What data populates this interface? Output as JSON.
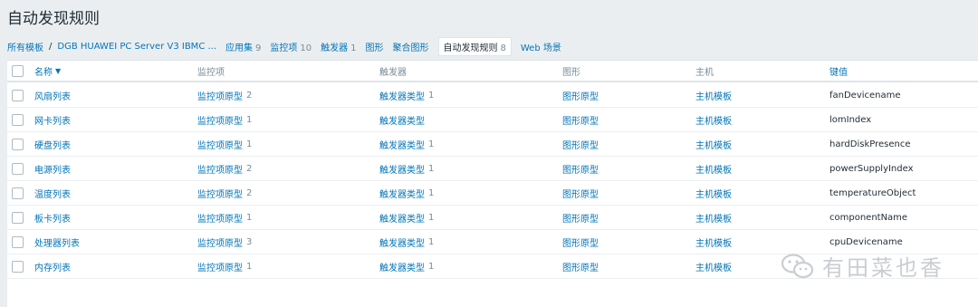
{
  "page": {
    "title": "自动发现规则"
  },
  "nav": {
    "all_templates": "所有模板",
    "separator": "/",
    "template_name": "DGB HUAWEI PC Server V3 IBMC ...",
    "applications": {
      "label": "应用集",
      "count": "9"
    },
    "items": {
      "label": "监控项",
      "count": "10"
    },
    "triggers": {
      "label": "触发器",
      "count": "1"
    },
    "graphs": {
      "label": "图形"
    },
    "screens": {
      "label": "聚合图形"
    },
    "discovery": {
      "label": "自动发现规则",
      "count": "8"
    },
    "web": {
      "label": "Web 场景"
    }
  },
  "table": {
    "headers": {
      "name": "名称",
      "sort_indicator": "▼",
      "items": "监控项",
      "triggers": "触发器",
      "graphs": "图形",
      "hosts": "主机",
      "key": "键值"
    },
    "rows": [
      {
        "name": "风扇列表",
        "items": "监控项原型",
        "items_count": "2",
        "triggers": "触发器类型",
        "triggers_count": "1",
        "graphs": "图形原型",
        "hosts": "主机模板",
        "key": "fanDevicename"
      },
      {
        "name": "网卡列表",
        "items": "监控项原型",
        "items_count": "1",
        "triggers": "触发器类型",
        "triggers_count": "",
        "graphs": "图形原型",
        "hosts": "主机模板",
        "key": "lomIndex"
      },
      {
        "name": "硬盘列表",
        "items": "监控项原型",
        "items_count": "1",
        "triggers": "触发器类型",
        "triggers_count": "1",
        "graphs": "图形原型",
        "hosts": "主机模板",
        "key": "hardDiskPresence"
      },
      {
        "name": "电源列表",
        "items": "监控项原型",
        "items_count": "2",
        "triggers": "触发器类型",
        "triggers_count": "1",
        "graphs": "图形原型",
        "hosts": "主机模板",
        "key": "powerSupplyIndex"
      },
      {
        "name": "温度列表",
        "items": "监控项原型",
        "items_count": "2",
        "triggers": "触发器类型",
        "triggers_count": "1",
        "graphs": "图形原型",
        "hosts": "主机模板",
        "key": "temperatureObject"
      },
      {
        "name": "板卡列表",
        "items": "监控项原型",
        "items_count": "1",
        "triggers": "触发器类型",
        "triggers_count": "1",
        "graphs": "图形原型",
        "hosts": "主机模板",
        "key": "componentName"
      },
      {
        "name": "处理器列表",
        "items": "监控项原型",
        "items_count": "3",
        "triggers": "触发器类型",
        "triggers_count": "1",
        "graphs": "图形原型",
        "hosts": "主机模板",
        "key": "cpuDevicename"
      },
      {
        "name": "内存列表",
        "items": "监控项原型",
        "items_count": "1",
        "triggers": "触发器类型",
        "triggers_count": "1",
        "graphs": "图形原型",
        "hosts": "主机模板",
        "key": ""
      }
    ]
  },
  "watermark": {
    "text": "有田菜也香",
    "icon": "wechat-icon"
  },
  "colors": {
    "link": "#0275b8",
    "muted": "#768d99",
    "background": "#ebeef0"
  }
}
